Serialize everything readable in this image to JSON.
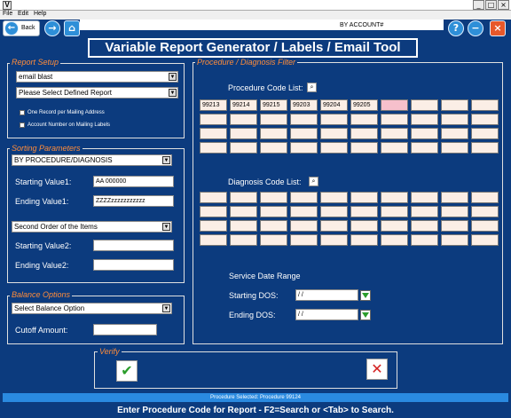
{
  "window": {
    "app_icon_glyph": "V",
    "minimize_glyph": "_",
    "maximize_glyph": "□",
    "close_glyph": "×"
  },
  "menu": {
    "file": "File",
    "edit": "Edit",
    "help": "Help"
  },
  "toolbar": {
    "back_label": "Back",
    "back_icon": "←",
    "forward_icon": "→",
    "home_icon": "⌂",
    "account_label": "BY ACCOUNT#",
    "help_icon": "?",
    "prev_icon": "−",
    "exit_icon": "×"
  },
  "title": "Variable Report Generator / Labels / Email Tool",
  "report_setup": {
    "legend": "Report Setup",
    "report_type": "email blast",
    "defined_report": "Please Select Defined Report",
    "one_record_label": "One Record per Mailing Address",
    "account_number_label": "Account Number on Mailing Labels"
  },
  "sorting": {
    "legend": "Sorting Parameters",
    "first_order": "BY PROCEDURE/DIAGNOSIS",
    "start1_label": "Starting Value1:",
    "start1_value": "AA      000000",
    "end1_label": "Ending   Value1:",
    "end1_value": "ZZZZzzzzzzzzzzz",
    "second_order": "Second Order of the Items",
    "start2_label": "Starting Value2:",
    "start2_value": "",
    "end2_label": "Ending   Value2:",
    "end2_value": ""
  },
  "balance": {
    "legend": "Balance Options",
    "option": "Select Balance Option",
    "cutoff_label": "Cutoff Amount:",
    "cutoff_value": ""
  },
  "filter": {
    "legend": "Procedure / Diagnosis Filter",
    "procedure_label": "Procedure Code List:",
    "procedure_codes": [
      [
        "99213",
        "99214",
        "99215",
        "99203",
        "99204",
        "99205",
        "",
        "",
        "",
        ""
      ],
      [
        "",
        "",
        "",
        "",
        "",
        "",
        "",
        "",
        "",
        ""
      ],
      [
        "",
        "",
        "",
        "",
        "",
        "",
        "",
        "",
        "",
        ""
      ],
      [
        "",
        "",
        "",
        "",
        "",
        "",
        "",
        "",
        "",
        ""
      ]
    ],
    "selected_cell": [
      0,
      6
    ],
    "diagnosis_label": "Diagnosis Code List:",
    "diagnosis_codes": [
      [
        "",
        "",
        "",
        "",
        "",
        "",
        "",
        "",
        "",
        ""
      ],
      [
        "",
        "",
        "",
        "",
        "",
        "",
        "",
        "",
        "",
        ""
      ],
      [
        "",
        "",
        "",
        "",
        "",
        "",
        "",
        "",
        "",
        ""
      ],
      [
        "",
        "",
        "",
        "",
        "",
        "",
        "",
        "",
        "",
        ""
      ]
    ],
    "date_range_label": "Service Date Range",
    "start_dos_label": "Starting DOS:",
    "start_dos_value": " / /",
    "end_dos_label": "Ending   DOS:",
    "end_dos_value": " / /"
  },
  "verify": {
    "legend": "Verify",
    "ok_glyph": "✔",
    "cancel_glyph": "✕",
    "ok_color": "#2a9d2a",
    "cancel_color": "#d42020"
  },
  "status": "Procedure Selected: Procedure 99124",
  "hint": "Enter Procedure Code for Report - F2=Search or <Tab> to Search."
}
